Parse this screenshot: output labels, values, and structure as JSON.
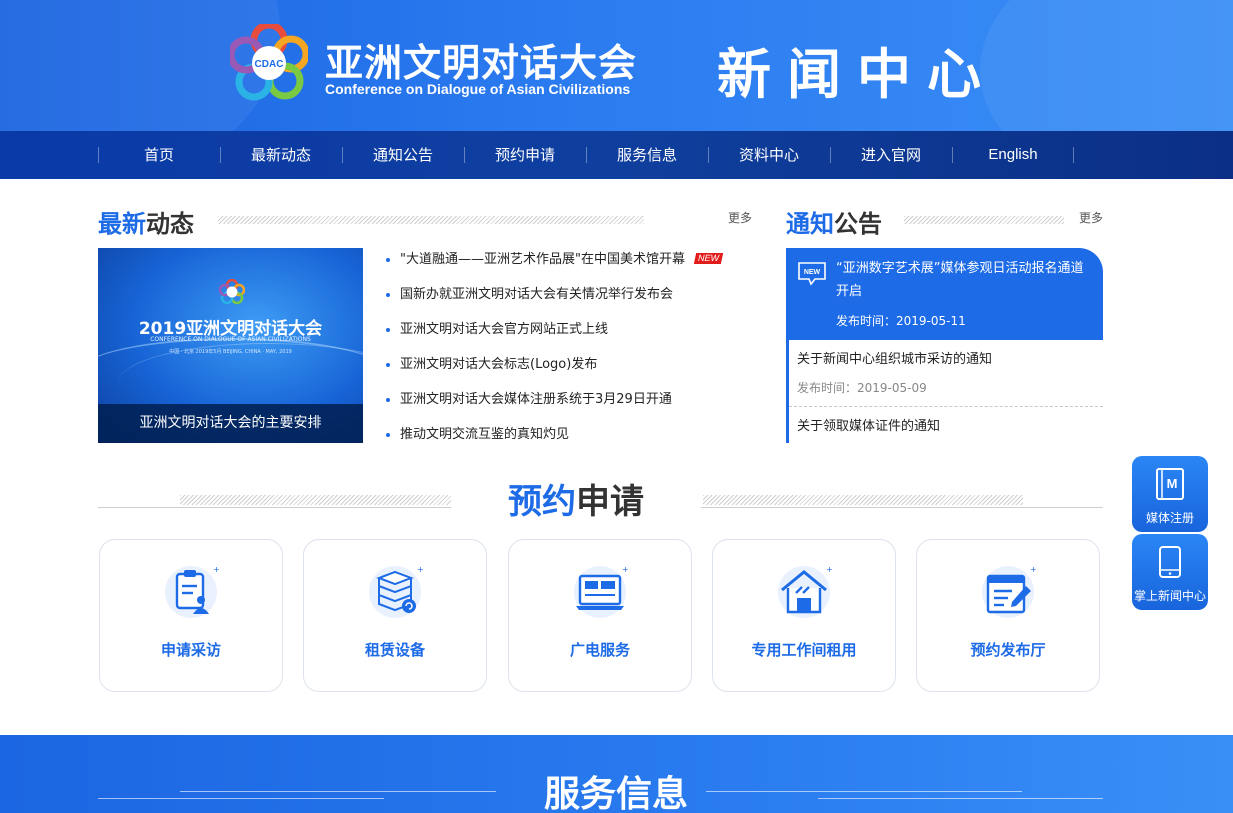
{
  "header": {
    "logo_badge": "CDAC",
    "org_name_cn": "亚洲文明对话大会",
    "org_name_en": "Conference on Dialogue of Asian Civilizations",
    "section_title": "新闻中心"
  },
  "nav": {
    "items": [
      "首页",
      "最新动态",
      "通知公告",
      "预约申请",
      "服务信息",
      "资料中心",
      "进入官网",
      "English"
    ]
  },
  "latest": {
    "title_a": "最新",
    "title_b": "动态",
    "more": "更多",
    "featured": {
      "headline": "2019亚洲文明对话大会",
      "subtitle_en": "CONFERENCE ON DIALOGUE OF ASIAN CIVILIZATIONS",
      "date_line": "中国 · 北京   2019年5月                BEIJING, CHINA · MAY, 2019",
      "caption": "亚洲文明对话大会的主要安排"
    },
    "items": [
      {
        "text": "\"大道融通——亚洲艺术作品展\"在中国美术馆开幕",
        "badge": "NEW"
      },
      {
        "text": "国新办就亚洲文明对话大会有关情况举行发布会",
        "badge": ""
      },
      {
        "text": "亚洲文明对话大会官方网站正式上线",
        "badge": ""
      },
      {
        "text": "亚洲文明对话大会标志(Logo)发布",
        "badge": ""
      },
      {
        "text": "亚洲文明对话大会媒体注册系统于3月29日开通",
        "badge": ""
      },
      {
        "text": "推动文明交流互鉴的真知灼见",
        "badge": ""
      }
    ]
  },
  "notices": {
    "title_a": "通知",
    "title_b": "公告",
    "more": "更多",
    "active": {
      "icon_label": "NEW",
      "title": "“亚洲数字艺术展”媒体参观日活动报名通道开启",
      "date": "发布时间：2019-05-11"
    },
    "items": [
      {
        "title": "关于新闻中心组织城市采访的通知",
        "date": "发布时间：2019-05-09"
      },
      {
        "title": "关于领取媒体证件的通知",
        "date": ""
      }
    ]
  },
  "booking": {
    "title_a": "预约",
    "title_b": "申请",
    "cards": [
      {
        "label": "申请采访",
        "icon": "clipboard-person-icon"
      },
      {
        "label": "租赁设备",
        "icon": "server-stack-icon"
      },
      {
        "label": "广电服务",
        "icon": "monitor-icon"
      },
      {
        "label": "专用工作间租用",
        "icon": "house-icon"
      },
      {
        "label": "预约发布厅",
        "icon": "document-pen-icon"
      }
    ]
  },
  "side": {
    "media_register": "媒体注册",
    "media_icon_letter": "M",
    "mobile_center": "掌上新闻中心"
  },
  "services": {
    "title": "服务信息"
  },
  "colors": {
    "brand_blue": "#1d6be6",
    "nav_dark": "#0f3f9e",
    "new_red": "#e21b1b"
  }
}
